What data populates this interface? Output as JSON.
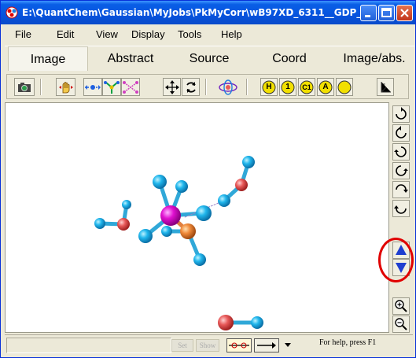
{
  "window": {
    "title": "E:\\QuantChem\\Gaussian\\MyJobs\\PkMyCorr\\wB97XD_6311__GDP_..."
  },
  "menu": {
    "items": [
      {
        "label": "File"
      },
      {
        "label": "Edit"
      },
      {
        "label": "View"
      },
      {
        "label": "Display"
      },
      {
        "label": "Tools"
      },
      {
        "label": "Help"
      }
    ]
  },
  "tabs": [
    {
      "label": "Image",
      "active": true
    },
    {
      "label": "Abstract",
      "active": false
    },
    {
      "label": "Source",
      "active": false
    },
    {
      "label": "Coord",
      "active": false
    },
    {
      "label": "Image/abs.",
      "active": false
    }
  ],
  "toolbar": {
    "label_buttons": [
      {
        "label": "H",
        "name": "label-hydrogen-button"
      },
      {
        "label": "1",
        "name": "label-number-button"
      },
      {
        "label": "C1",
        "name": "label-atom-number-button"
      },
      {
        "label": "A",
        "name": "label-atom-button"
      }
    ]
  },
  "colors": {
    "titlebar": "#0553DE",
    "hydrogen": "#1FB4E8",
    "oxygen": "#E85A5A",
    "metal": "#E010D0",
    "phosphorus": "#F08A3A",
    "highlight": "#E00000",
    "label_button": "#F2E000"
  },
  "status": {
    "set_label": "Set",
    "show_label": "Show",
    "help_text": "For help, press F1"
  }
}
